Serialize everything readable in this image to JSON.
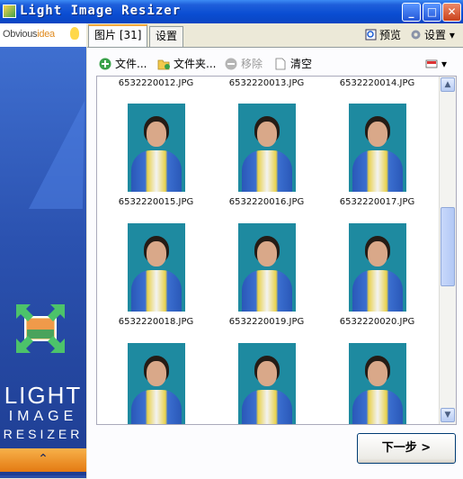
{
  "window": {
    "title": "Light Image Resizer"
  },
  "sidebar": {
    "logo_prefix": "Obvious",
    "logo_suffix": "idea",
    "brand_line1": "LIGHT",
    "brand_line2": "IMAGE",
    "brand_line3": "RESIZER",
    "collapse_glyph": "⌃"
  },
  "tabs": [
    {
      "label": "图片 [31]"
    },
    {
      "label": "设置"
    }
  ],
  "top_right": {
    "preview_label": "预览",
    "settings_label": "设置 ▾"
  },
  "toolbar": {
    "add_files_label": "文件...",
    "add_folder_label": "文件夹...",
    "remove_label": "移除",
    "clear_label": "清空",
    "view_glyph": "▾"
  },
  "gallery": {
    "top_captions": [
      "6532220012.JPG",
      "6532220013.JPG",
      "6532220014.JPG"
    ],
    "rows": [
      [
        "6532220015.JPG",
        "6532220016.JPG",
        "6532220017.JPG"
      ],
      [
        "6532220018.JPG",
        "6532220019.JPG",
        "6532220020.JPG"
      ],
      [
        "",
        "",
        ""
      ]
    ]
  },
  "next_button_label": "下一步 >",
  "colors": {
    "titlebar": "#0A4DD2",
    "sidebar": "#2a4ea8",
    "photo_background": "#1e8aa0",
    "tab_accent": "#f5a83b"
  }
}
